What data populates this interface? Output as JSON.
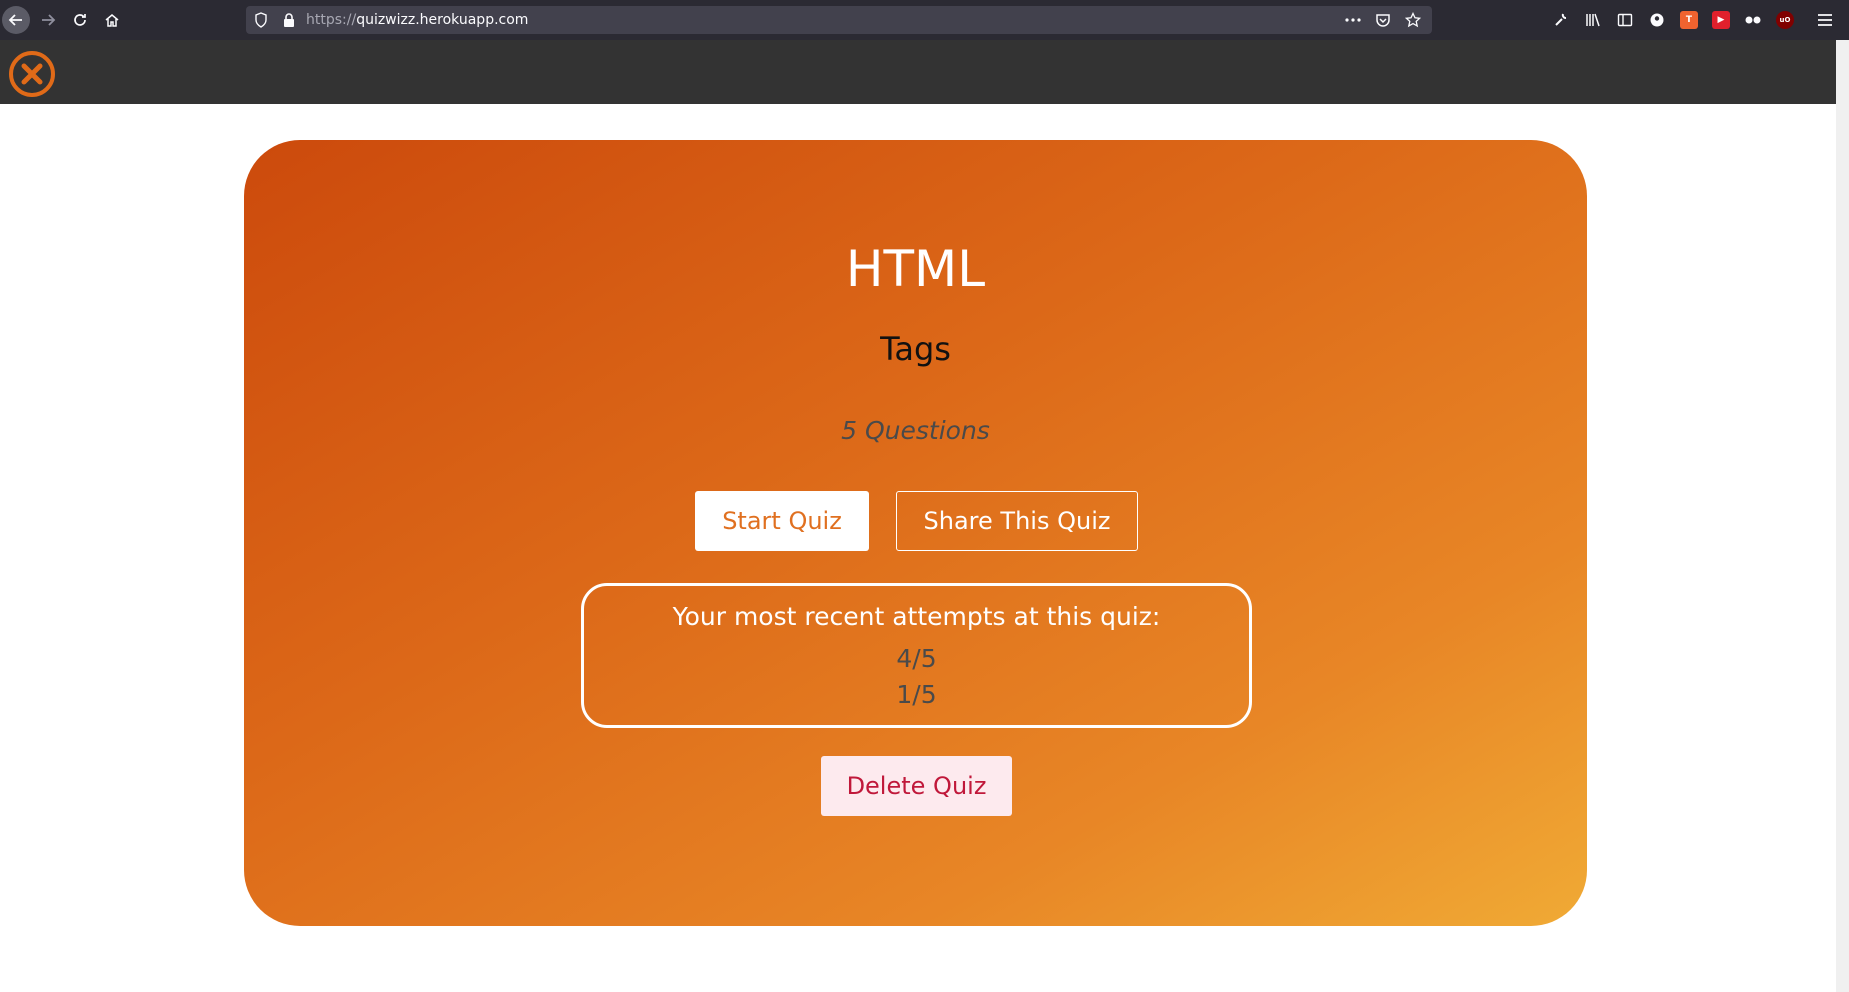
{
  "browser": {
    "url_scheme": "https://",
    "url_host": "quizwizz.herokuapp.com"
  },
  "colors": {
    "card_gradient_start": "#cc4a0c",
    "card_gradient_end": "#f0aa35",
    "header_bg": "#333333",
    "delete_text": "#c0183a",
    "delete_bg": "#fdeaee"
  },
  "app": {
    "logo_icon": "close-circle-icon"
  },
  "quiz": {
    "title": "HTML",
    "subtitle": "Tags",
    "question_count": "5 Questions",
    "start_label": "Start Quiz",
    "share_label": "Share This Quiz",
    "attempts_label": "Your most recent attempts at this quiz:",
    "attempts": [
      "4/5",
      "1/5"
    ],
    "delete_label": "Delete Quiz"
  }
}
